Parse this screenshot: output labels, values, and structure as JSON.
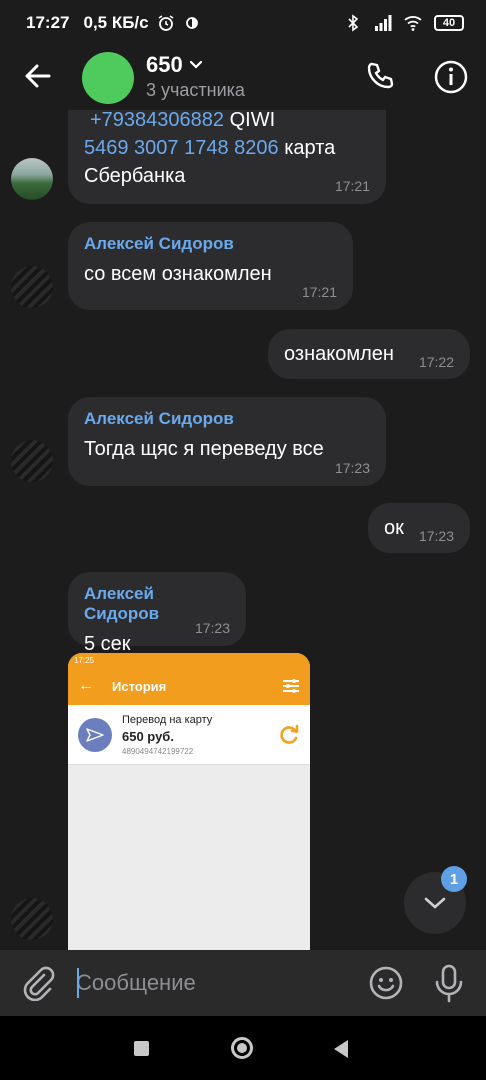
{
  "status_bar": {
    "time": "17:27",
    "speed": "0,5 КБ/с",
    "battery": "40"
  },
  "header": {
    "title": "650",
    "subtitle": "3 участника"
  },
  "messages": [
    {
      "line1": "+79384306882",
      "line1_suffix": " QIWI",
      "line2": "5469 3007 1748 8206",
      "line2_suffix": " карта",
      "line3": "Сбербанка",
      "time": "17:21"
    },
    {
      "sender": "Алексей Сидоров",
      "text": "со всем ознакомлен",
      "time": "17:21"
    },
    {
      "text": "ознакомлен",
      "time": "17:22"
    },
    {
      "sender": "Алексей Сидоров",
      "text": "Тогда щяс я переведу все",
      "time": "17:23"
    },
    {
      "text": "ок",
      "time": "17:23"
    },
    {
      "sender": "Алексей Сидоров",
      "text": "5 сек",
      "time": "17:23"
    }
  ],
  "screenshot": {
    "status_time": "17:25",
    "title": "История",
    "item_title": "Перевод на карту",
    "item_amount": "650 руб.",
    "item_card": "4890494742199722"
  },
  "scroll_badge": "1",
  "input": {
    "placeholder": "Сообщение"
  }
}
